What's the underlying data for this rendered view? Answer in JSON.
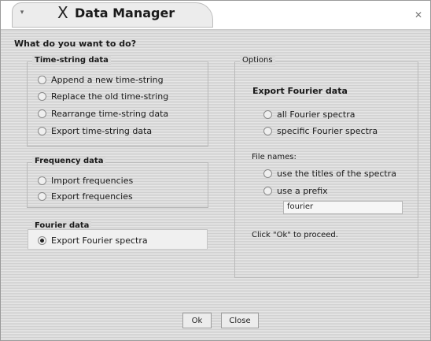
{
  "window": {
    "title": "Data Manager",
    "menu_glyph": "▾",
    "title_icon": "X",
    "close_glyph": "✕"
  },
  "prompt": "What do you want to do?",
  "time_string": {
    "title": "Time-string data",
    "options": [
      "Append a new time-string",
      "Replace the old time-string",
      "Rearrange time-string data",
      "Export time-string data"
    ]
  },
  "frequency": {
    "title": "Frequency data",
    "options": [
      "Import frequencies",
      "Export frequencies"
    ]
  },
  "fourier": {
    "title": "Fourier data",
    "options": [
      "Export Fourier spectra"
    ],
    "selected": "Export Fourier spectra"
  },
  "options_panel": {
    "title": "Options",
    "header": "Export Fourier data",
    "spectra_options": [
      "all Fourier spectra",
      "specific Fourier spectra"
    ],
    "file_names_label": "File names:",
    "file_name_options": [
      "use the titles of the spectra",
      "use a prefix"
    ],
    "prefix_value": "fourier",
    "proceed_text": "Click \"Ok\" to proceed."
  },
  "buttons": {
    "ok": "Ok",
    "close": "Close"
  }
}
